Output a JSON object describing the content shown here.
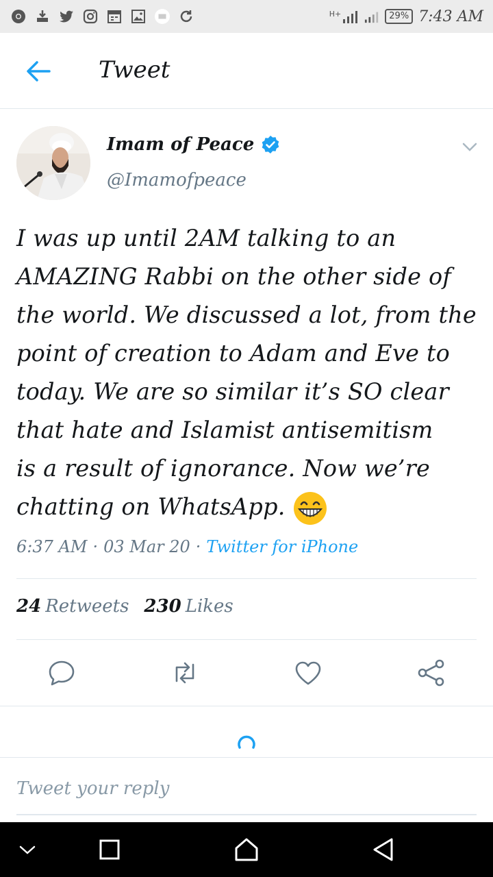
{
  "status_bar": {
    "icons": [
      "chrome-icon",
      "download-icon",
      "twitter-icon",
      "instagram-icon",
      "calendar-icon",
      "gallery-icon",
      "mail-icon",
      "sync-icon"
    ],
    "signal": "H+",
    "battery": "29%",
    "time": "7:43 AM"
  },
  "header": {
    "title": "Tweet"
  },
  "tweet": {
    "author_name": "Imam of Peace",
    "author_handle": "@Imamofpeace",
    "text": "I was up until 2AM talking to an\nAMAZING Rabbi on the other side of\nthe world. We discussed a lot, from the\npoint of creation to Adam and Eve to\ntoday. We are so similar it’s SO clear\nthat hate and Islamist antisemitism\nis a result of ignorance. Now we’re\nchatting on WhatsApp.",
    "time": "6:37 AM",
    "date": "03 Mar 20",
    "source": "Twitter for iPhone",
    "separator": "·"
  },
  "stats": {
    "retweets_count": "24",
    "retweets_label": "Retweets",
    "likes_count": "230",
    "likes_label": "Likes"
  },
  "reply": {
    "placeholder": "Tweet your reply"
  },
  "colors": {
    "accent": "#1da1f2",
    "muted": "#657786",
    "text": "#14171a"
  }
}
